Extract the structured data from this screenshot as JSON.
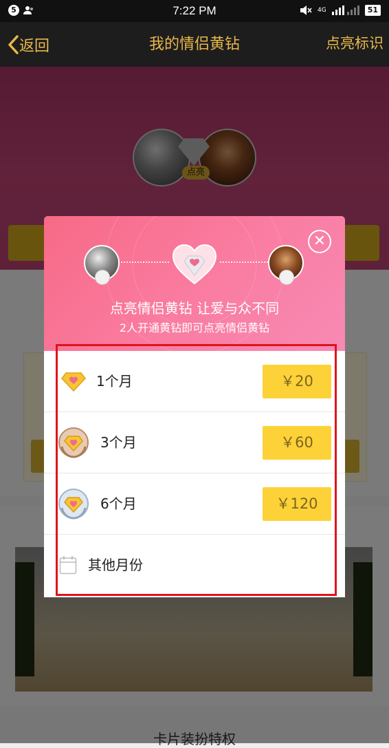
{
  "status_bar": {
    "time": "7:22 PM",
    "notification_count": "5",
    "network": "4G",
    "battery": "51"
  },
  "nav": {
    "back_label": "返回",
    "title": "我的情侣黄钻",
    "action_label": "点亮标识"
  },
  "hero": {
    "light_up_label": "点亮"
  },
  "modal": {
    "title": "点亮情侣黄钻 让爱与众不同",
    "subtitle": "2人开通黄钻即可点亮情侣黄钻",
    "options": [
      {
        "label": "1个月",
        "price": "￥20",
        "icon": "yellow-diamond-icon"
      },
      {
        "label": "3个月",
        "price": "￥60",
        "icon": "bronze-diamond-badge-icon"
      },
      {
        "label": "6个月",
        "price": "￥120",
        "icon": "silver-diamond-badge-icon"
      },
      {
        "label": "其他月份",
        "icon": "calendar-icon"
      }
    ]
  },
  "background": {
    "bottom_section_label": "卡片装扮特权"
  },
  "colors": {
    "nav_text": "#e9b84a",
    "price_button": "#fcd238",
    "modal_header": "#f87a9c",
    "highlight_border": "#e0121b"
  }
}
